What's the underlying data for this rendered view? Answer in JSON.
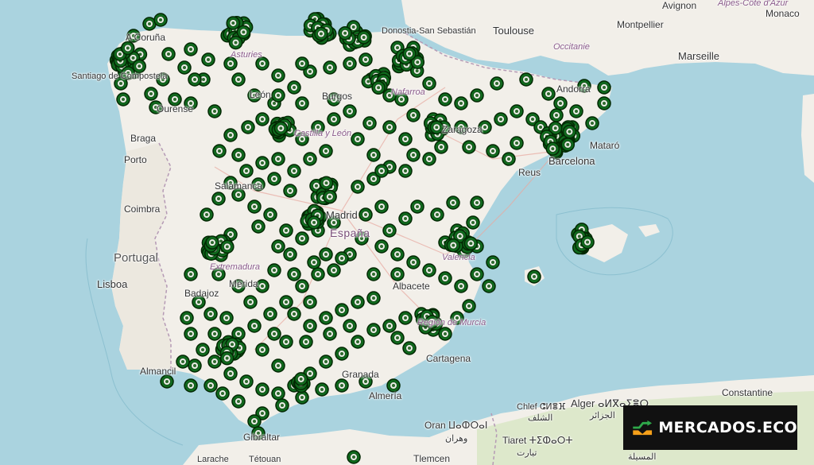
{
  "brand": {
    "name": "MERCADOS.ECO",
    "colors": {
      "accent_orange": "#f5a01a",
      "accent_green": "#2ea84a",
      "panel": "#111111"
    }
  },
  "map": {
    "colors": {
      "sea": "#aad3df",
      "land": "#f2efe9",
      "land_green": "#cfe3b8",
      "marker_fill": "#0f6a1d",
      "marker_ring": "#032803"
    },
    "labels": {
      "avignon": "Avignon",
      "alpes": "Alpes-Côte d'Azur",
      "monaco": "Monaco",
      "toulouse": "Toulouse",
      "occitanie": "Occitanie",
      "montpellier": "Montpellier",
      "marseille": "Marseille",
      "donostia": "Donostia-San Sebastián",
      "coruna": "A Coruña",
      "santiago": "Santiago de Compostela",
      "asturies": "Asturies",
      "navarro": "Nafarroa",
      "andorra": "Andorra",
      "leon": "León",
      "burgos": "Burgos",
      "ourense": "Ourense",
      "braga": "Braga",
      "castilla": "Castilla y León",
      "zaragoza": "Zaragoza",
      "mataro": "Mataró",
      "barcelona": "Barcelona",
      "porto": "Porto",
      "salamanca": "Salamanca",
      "reus": "Reus",
      "madrid": "Madrid",
      "coimbra": "Coimbra",
      "espana": "España",
      "portugal": "Portugal",
      "extremadura": "Extremadura",
      "valencia": "Valencia",
      "lisboa": "Lisboa",
      "merida": "Mérida",
      "albacete": "Albacete",
      "badajoz": "Badajoz",
      "murcia": "Región de Murcia",
      "cartagena": "Cartagena",
      "almancil": "Almancil",
      "granada": "Granada",
      "almeria": "Almería",
      "gibraltar": "Gibraltar",
      "algeria": "Alger ⴰⵍⴳⴰⵢⴻⵔ",
      "alger_ar": "الجزائر",
      "constantine": "Constantine",
      "chlef": "Chlef ⵛⵍⴻⴼ",
      "chlef_ar": "الشلف",
      "oran": "Oran ⵡⴰⵀⵔⴰⵏ",
      "oran_ar": "وهران",
      "tiaret": "Tiaret ⵜⵉⵀⴰⵔⵜ",
      "tiaret_ar": "تيارت",
      "tlemcen": "Tlemcen",
      "larache": "Larache",
      "tetouan": "Tétouan",
      "msila": "المسيلة"
    }
  }
}
